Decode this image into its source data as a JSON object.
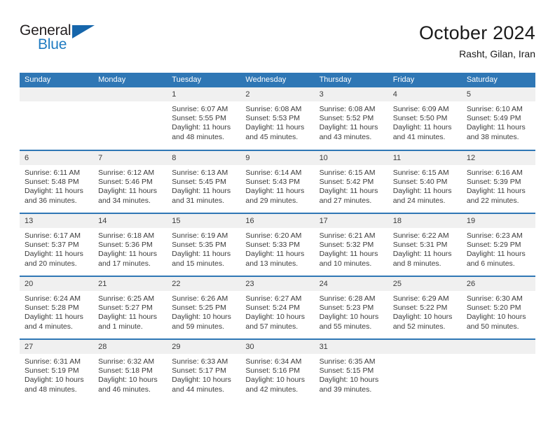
{
  "brand": {
    "name_top": "General",
    "name_bottom": "Blue",
    "color_dark": "#231f20",
    "color_blue": "#1f7bc1",
    "flag_color": "#1666ab"
  },
  "header": {
    "title": "October 2024",
    "subtitle": "Rasht, Gilan, Iran"
  },
  "theme": {
    "header_bg": "#2f77b5",
    "daynum_bg": "#f0f0f0",
    "text": "#3b3b3b",
    "separator": "#2f77b5"
  },
  "calendar": {
    "weekdays": [
      "Sunday",
      "Monday",
      "Tuesday",
      "Wednesday",
      "Thursday",
      "Friday",
      "Saturday"
    ],
    "weeks": [
      [
        {
          "day": "",
          "empty": true
        },
        {
          "day": "",
          "empty": true
        },
        {
          "day": "1",
          "sunrise": "Sunrise: 6:07 AM",
          "sunset": "Sunset: 5:55 PM",
          "daylight1": "Daylight: 11 hours",
          "daylight2": "and 48 minutes."
        },
        {
          "day": "2",
          "sunrise": "Sunrise: 6:08 AM",
          "sunset": "Sunset: 5:53 PM",
          "daylight1": "Daylight: 11 hours",
          "daylight2": "and 45 minutes."
        },
        {
          "day": "3",
          "sunrise": "Sunrise: 6:08 AM",
          "sunset": "Sunset: 5:52 PM",
          "daylight1": "Daylight: 11 hours",
          "daylight2": "and 43 minutes."
        },
        {
          "day": "4",
          "sunrise": "Sunrise: 6:09 AM",
          "sunset": "Sunset: 5:50 PM",
          "daylight1": "Daylight: 11 hours",
          "daylight2": "and 41 minutes."
        },
        {
          "day": "5",
          "sunrise": "Sunrise: 6:10 AM",
          "sunset": "Sunset: 5:49 PM",
          "daylight1": "Daylight: 11 hours",
          "daylight2": "and 38 minutes."
        }
      ],
      [
        {
          "day": "6",
          "sunrise": "Sunrise: 6:11 AM",
          "sunset": "Sunset: 5:48 PM",
          "daylight1": "Daylight: 11 hours",
          "daylight2": "and 36 minutes."
        },
        {
          "day": "7",
          "sunrise": "Sunrise: 6:12 AM",
          "sunset": "Sunset: 5:46 PM",
          "daylight1": "Daylight: 11 hours",
          "daylight2": "and 34 minutes."
        },
        {
          "day": "8",
          "sunrise": "Sunrise: 6:13 AM",
          "sunset": "Sunset: 5:45 PM",
          "daylight1": "Daylight: 11 hours",
          "daylight2": "and 31 minutes."
        },
        {
          "day": "9",
          "sunrise": "Sunrise: 6:14 AM",
          "sunset": "Sunset: 5:43 PM",
          "daylight1": "Daylight: 11 hours",
          "daylight2": "and 29 minutes."
        },
        {
          "day": "10",
          "sunrise": "Sunrise: 6:15 AM",
          "sunset": "Sunset: 5:42 PM",
          "daylight1": "Daylight: 11 hours",
          "daylight2": "and 27 minutes."
        },
        {
          "day": "11",
          "sunrise": "Sunrise: 6:15 AM",
          "sunset": "Sunset: 5:40 PM",
          "daylight1": "Daylight: 11 hours",
          "daylight2": "and 24 minutes."
        },
        {
          "day": "12",
          "sunrise": "Sunrise: 6:16 AM",
          "sunset": "Sunset: 5:39 PM",
          "daylight1": "Daylight: 11 hours",
          "daylight2": "and 22 minutes."
        }
      ],
      [
        {
          "day": "13",
          "sunrise": "Sunrise: 6:17 AM",
          "sunset": "Sunset: 5:37 PM",
          "daylight1": "Daylight: 11 hours",
          "daylight2": "and 20 minutes."
        },
        {
          "day": "14",
          "sunrise": "Sunrise: 6:18 AM",
          "sunset": "Sunset: 5:36 PM",
          "daylight1": "Daylight: 11 hours",
          "daylight2": "and 17 minutes."
        },
        {
          "day": "15",
          "sunrise": "Sunrise: 6:19 AM",
          "sunset": "Sunset: 5:35 PM",
          "daylight1": "Daylight: 11 hours",
          "daylight2": "and 15 minutes."
        },
        {
          "day": "16",
          "sunrise": "Sunrise: 6:20 AM",
          "sunset": "Sunset: 5:33 PM",
          "daylight1": "Daylight: 11 hours",
          "daylight2": "and 13 minutes."
        },
        {
          "day": "17",
          "sunrise": "Sunrise: 6:21 AM",
          "sunset": "Sunset: 5:32 PM",
          "daylight1": "Daylight: 11 hours",
          "daylight2": "and 10 minutes."
        },
        {
          "day": "18",
          "sunrise": "Sunrise: 6:22 AM",
          "sunset": "Sunset: 5:31 PM",
          "daylight1": "Daylight: 11 hours",
          "daylight2": "and 8 minutes."
        },
        {
          "day": "19",
          "sunrise": "Sunrise: 6:23 AM",
          "sunset": "Sunset: 5:29 PM",
          "daylight1": "Daylight: 11 hours",
          "daylight2": "and 6 minutes."
        }
      ],
      [
        {
          "day": "20",
          "sunrise": "Sunrise: 6:24 AM",
          "sunset": "Sunset: 5:28 PM",
          "daylight1": "Daylight: 11 hours",
          "daylight2": "and 4 minutes."
        },
        {
          "day": "21",
          "sunrise": "Sunrise: 6:25 AM",
          "sunset": "Sunset: 5:27 PM",
          "daylight1": "Daylight: 11 hours",
          "daylight2": "and 1 minute."
        },
        {
          "day": "22",
          "sunrise": "Sunrise: 6:26 AM",
          "sunset": "Sunset: 5:25 PM",
          "daylight1": "Daylight: 10 hours",
          "daylight2": "and 59 minutes."
        },
        {
          "day": "23",
          "sunrise": "Sunrise: 6:27 AM",
          "sunset": "Sunset: 5:24 PM",
          "daylight1": "Daylight: 10 hours",
          "daylight2": "and 57 minutes."
        },
        {
          "day": "24",
          "sunrise": "Sunrise: 6:28 AM",
          "sunset": "Sunset: 5:23 PM",
          "daylight1": "Daylight: 10 hours",
          "daylight2": "and 55 minutes."
        },
        {
          "day": "25",
          "sunrise": "Sunrise: 6:29 AM",
          "sunset": "Sunset: 5:22 PM",
          "daylight1": "Daylight: 10 hours",
          "daylight2": "and 52 minutes."
        },
        {
          "day": "26",
          "sunrise": "Sunrise: 6:30 AM",
          "sunset": "Sunset: 5:20 PM",
          "daylight1": "Daylight: 10 hours",
          "daylight2": "and 50 minutes."
        }
      ],
      [
        {
          "day": "27",
          "sunrise": "Sunrise: 6:31 AM",
          "sunset": "Sunset: 5:19 PM",
          "daylight1": "Daylight: 10 hours",
          "daylight2": "and 48 minutes."
        },
        {
          "day": "28",
          "sunrise": "Sunrise: 6:32 AM",
          "sunset": "Sunset: 5:18 PM",
          "daylight1": "Daylight: 10 hours",
          "daylight2": "and 46 minutes."
        },
        {
          "day": "29",
          "sunrise": "Sunrise: 6:33 AM",
          "sunset": "Sunset: 5:17 PM",
          "daylight1": "Daylight: 10 hours",
          "daylight2": "and 44 minutes."
        },
        {
          "day": "30",
          "sunrise": "Sunrise: 6:34 AM",
          "sunset": "Sunset: 5:16 PM",
          "daylight1": "Daylight: 10 hours",
          "daylight2": "and 42 minutes."
        },
        {
          "day": "31",
          "sunrise": "Sunrise: 6:35 AM",
          "sunset": "Sunset: 5:15 PM",
          "daylight1": "Daylight: 10 hours",
          "daylight2": "and 39 minutes."
        },
        {
          "day": "",
          "empty": true
        },
        {
          "day": "",
          "empty": true
        }
      ]
    ]
  }
}
